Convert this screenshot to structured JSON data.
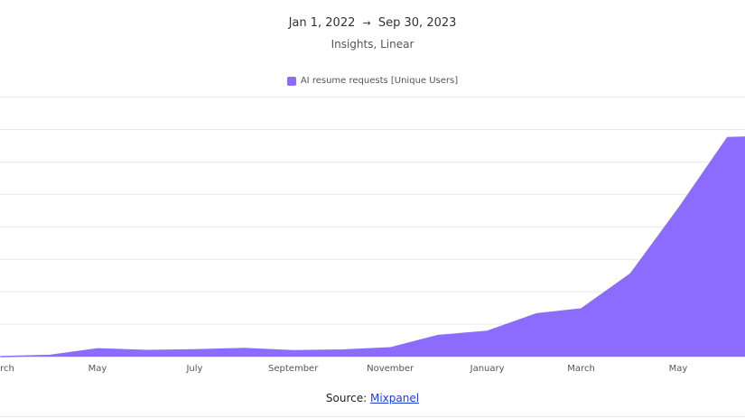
{
  "header": {
    "date_start": "Jan 1, 2022",
    "date_arrow": "→",
    "date_end": "Sep 30, 2023",
    "subtitle": "Insights, Linear"
  },
  "legend": {
    "label": "AI resume requests [Unique Users]",
    "color": "#8b6cff"
  },
  "source": {
    "prefix": "Source: ",
    "link_text": "Mixpanel"
  },
  "chart_data": {
    "type": "area",
    "series": [
      {
        "name": "AI resume requests [Unique Users]",
        "color": "#8b6cff",
        "points": [
          {
            "x": "2022-03-01",
            "y": 0
          },
          {
            "x": "2022-04-01",
            "y": 0.4
          },
          {
            "x": "2022-05-01",
            "y": 2.4
          },
          {
            "x": "2022-06-01",
            "y": 1.9
          },
          {
            "x": "2022-07-01",
            "y": 2.1
          },
          {
            "x": "2022-08-01",
            "y": 2.5
          },
          {
            "x": "2022-09-01",
            "y": 1.8
          },
          {
            "x": "2022-10-01",
            "y": 2.0
          },
          {
            "x": "2022-11-01",
            "y": 2.7
          },
          {
            "x": "2022-12-01",
            "y": 6.5
          },
          {
            "x": "2023-01-01",
            "y": 7.8
          },
          {
            "x": "2023-02-01",
            "y": 13.2
          },
          {
            "x": "2023-03-01",
            "y": 14.7
          },
          {
            "x": "2023-04-01",
            "y": 25.5
          },
          {
            "x": "2023-05-01",
            "y": 45.5
          },
          {
            "x": "2023-06-01",
            "y": 67.5
          },
          {
            "x": "2023-06-30",
            "y": 68
          }
        ]
      }
    ],
    "x_ticks": [
      {
        "x": "2022-03-01",
        "label": "March"
      },
      {
        "x": "2022-05-01",
        "label": "May"
      },
      {
        "x": "2022-07-01",
        "label": "July"
      },
      {
        "x": "2022-09-01",
        "label": "September"
      },
      {
        "x": "2022-11-01",
        "label": "November"
      },
      {
        "x": "2023-01-01",
        "label": "January"
      },
      {
        "x": "2023-03-01",
        "label": "March"
      },
      {
        "x": "2023-05-01",
        "label": "May"
      }
    ],
    "ylim": [
      0,
      81
    ],
    "y_gridlines": [
      0,
      10,
      20,
      30,
      40,
      50,
      60,
      70,
      80
    ],
    "grid": true,
    "legend_position": "top-center"
  }
}
